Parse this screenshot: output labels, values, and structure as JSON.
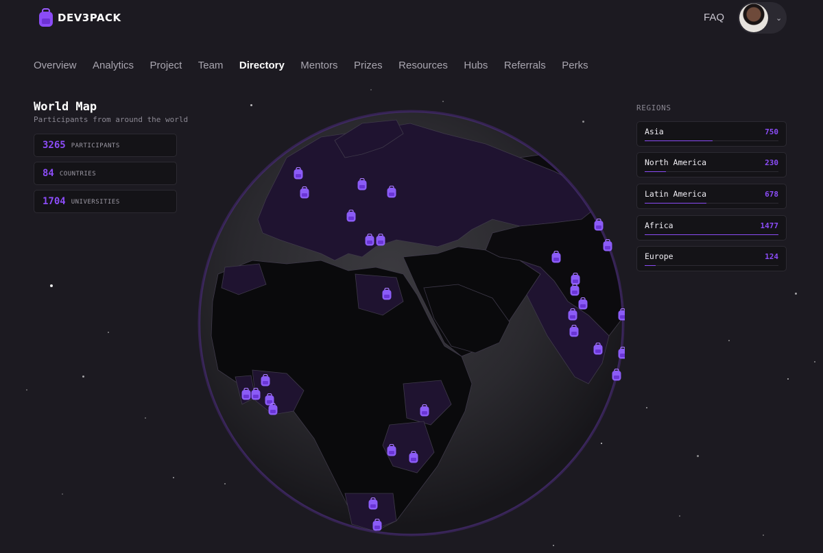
{
  "brand": {
    "name": "DEV3PACK"
  },
  "header": {
    "faq_label": "FAQ",
    "account_chevron": "⌄"
  },
  "nav": {
    "items": [
      {
        "label": "Overview",
        "active": false
      },
      {
        "label": "Analytics",
        "active": false
      },
      {
        "label": "Project",
        "active": false
      },
      {
        "label": "Team",
        "active": false
      },
      {
        "label": "Directory",
        "active": true
      },
      {
        "label": "Mentors",
        "active": false
      },
      {
        "label": "Prizes",
        "active": false
      },
      {
        "label": "Resources",
        "active": false
      },
      {
        "label": "Hubs",
        "active": false
      },
      {
        "label": "Referrals",
        "active": false
      },
      {
        "label": "Perks",
        "active": false
      }
    ]
  },
  "map": {
    "title": "World Map",
    "subtitle": "Participants from around the world",
    "stats": [
      {
        "value": "3265",
        "label": "PARTICIPANTS"
      },
      {
        "value": "84",
        "label": "COUNTRIES"
      },
      {
        "value": "1704",
        "label": "UNIVERSITIES"
      }
    ]
  },
  "regions": {
    "title": "REGIONS",
    "items": [
      {
        "name": "Asia",
        "count": "750"
      },
      {
        "name": "North America",
        "count": "230"
      },
      {
        "name": "Latin America",
        "count": "678"
      },
      {
        "name": "Africa",
        "count": "1477"
      },
      {
        "name": "Europe",
        "count": "124"
      }
    ]
  },
  "theme": {
    "accent": "#8b4cf7",
    "background": "#1c1a21",
    "card": "#141317",
    "highlighted_country": "#1f1330",
    "land": "#0a0a0c"
  },
  "icons": {
    "logo": "backpack-icon",
    "marker": "backpack-marker-icon",
    "account_chevron": "chevron-down-icon"
  }
}
